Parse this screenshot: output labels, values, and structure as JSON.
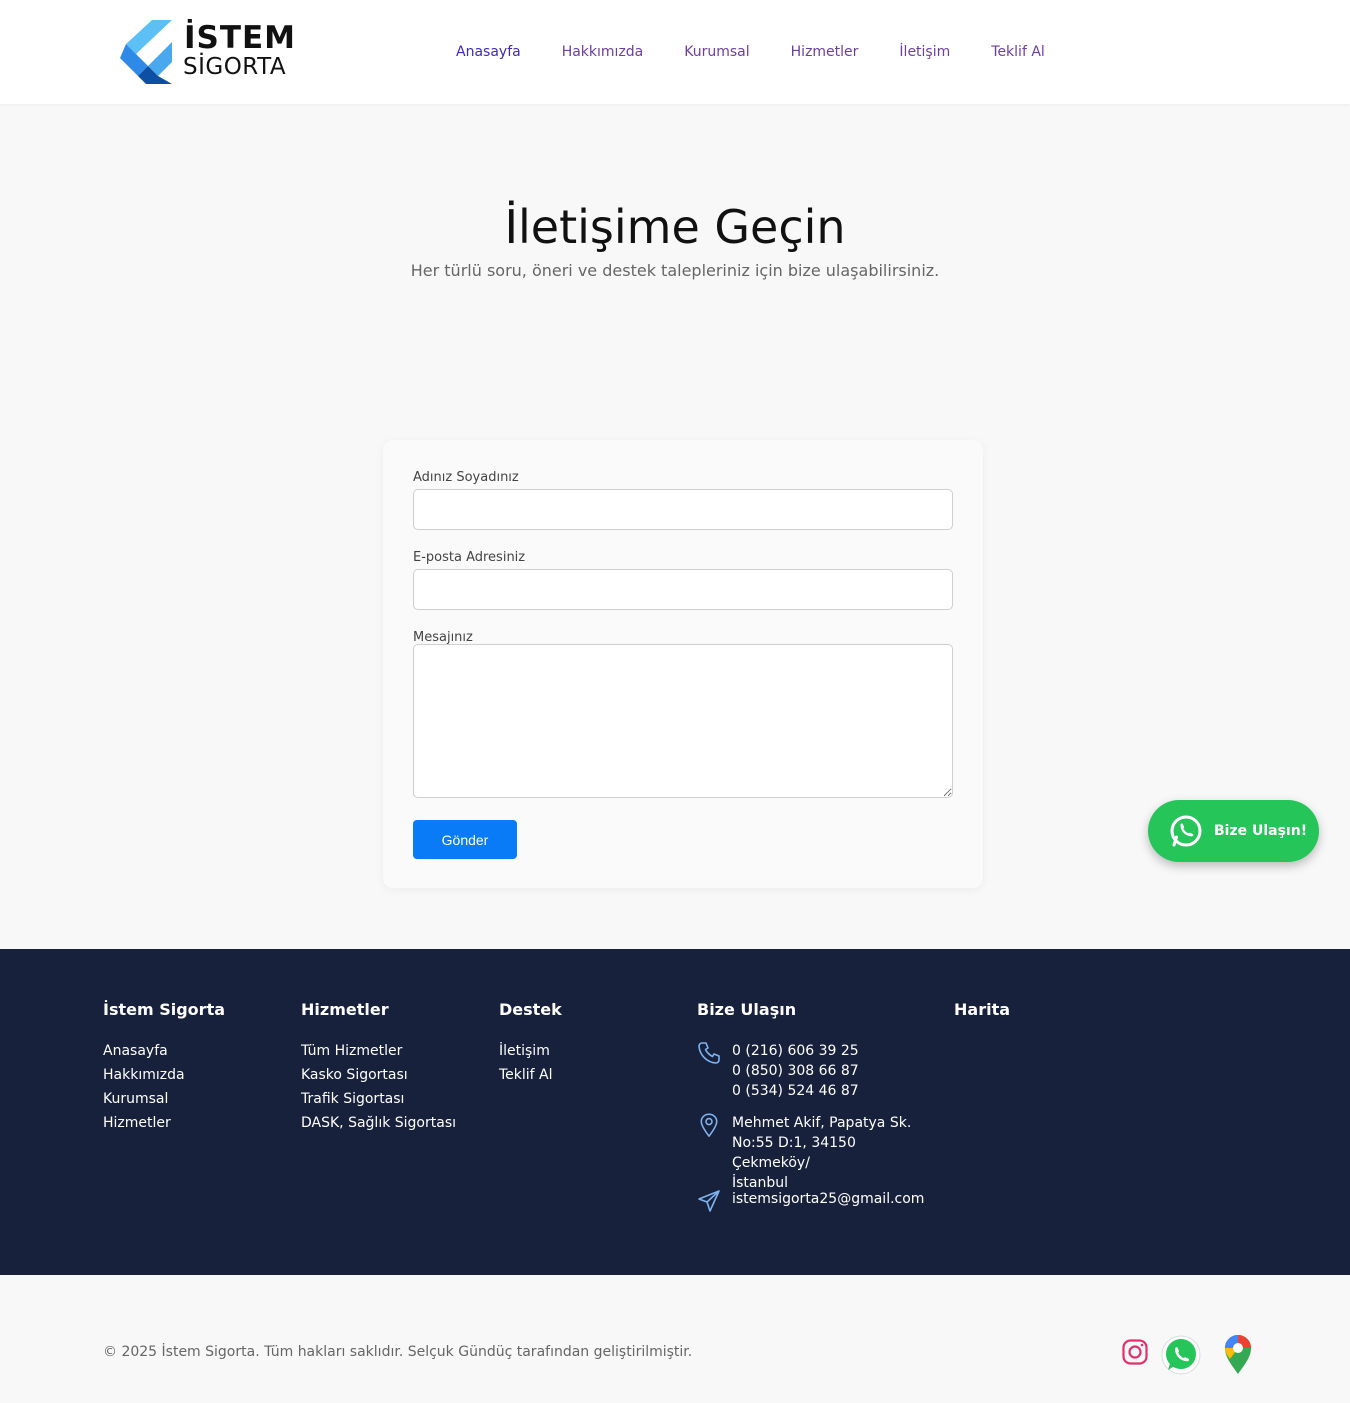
{
  "brand": {
    "name_line1": "İSTEM",
    "name_line2": "SİGORTA",
    "colors": {
      "light_blue": "#5cc0f5",
      "mid_blue": "#2e8ae6",
      "dark_blue": "#0d4fa3"
    }
  },
  "nav": {
    "items": [
      {
        "label": "Anasayfa",
        "active": true
      },
      {
        "label": "Hakkımızda"
      },
      {
        "label": "Kurumsal"
      },
      {
        "label": "Hizmetler"
      },
      {
        "label": "İletişim"
      },
      {
        "label": "Teklif Al"
      }
    ]
  },
  "hero": {
    "title": "İletişime Geçin",
    "subtitle": "Her türlü soru, öneri ve destek talepleriniz için bize ulaşabilirsiniz."
  },
  "form": {
    "name_label": "Adınız Soyadınız",
    "name_value": "",
    "email_label": "E-posta Adresiniz",
    "email_value": "",
    "message_label": "Mesajınız",
    "message_value": "",
    "submit_label": "Gönder",
    "accent": "#0a7bf7"
  },
  "whatsapp_float": {
    "label": "Bize Ulaşın!",
    "icon": "whatsapp-icon",
    "color": "#25c55a"
  },
  "footer": {
    "bg": "#18213c",
    "col1": {
      "title": "İstem Sigorta",
      "links": [
        "Anasayfa",
        "Hakkımızda",
        "Kurumsal",
        "Hizmetler"
      ]
    },
    "col2": {
      "title": "Hizmetler",
      "links": [
        "Tüm Hizmetler",
        "Kasko Sigortası",
        "Trafik Sigortası",
        "DASK, Sağlık Sigortası"
      ]
    },
    "col3": {
      "title": "Destek",
      "links": [
        "İletişim",
        "Teklif Al"
      ]
    },
    "contact": {
      "title": "Bize Ulaşın",
      "phones": [
        "0 (216) 606 39 25",
        "0 (850) 308 66 87",
        "0 (534) 524 46 87"
      ],
      "address_lines": [
        "Mehmet Akif, Papatya Sk.",
        "No:55 D:1, 34150 Çekmeköy/",
        "İstanbul"
      ],
      "email": "istemsigorta25@gmail.com"
    },
    "map": {
      "title": "Harita"
    }
  },
  "bottom": {
    "copyright": "© 2025 İstem Sigorta. Tüm hakları saklıdır. Selçuk Gündüç tarafından geliştirilmiştir.",
    "social": [
      "instagram-icon",
      "whatsapp-icon",
      "google-maps-icon"
    ]
  }
}
